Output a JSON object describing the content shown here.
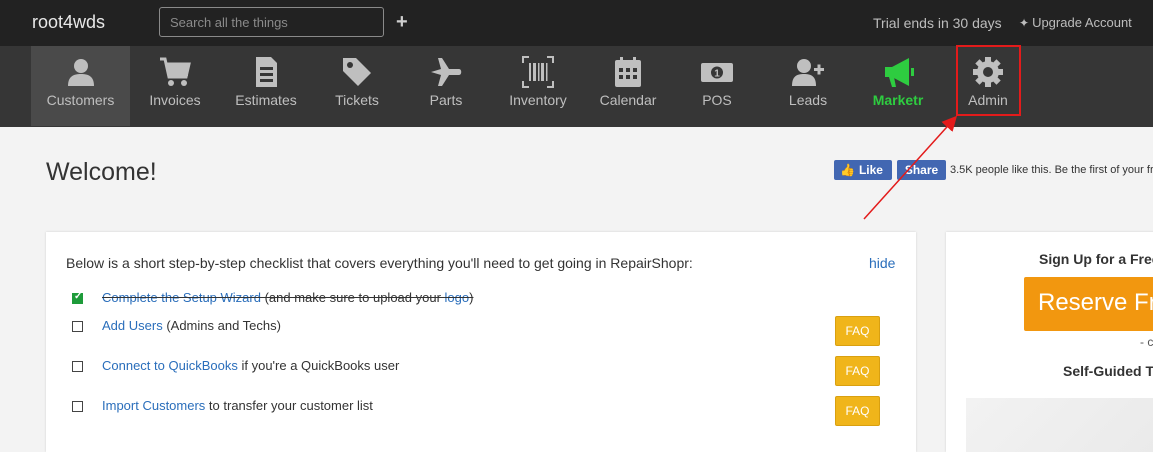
{
  "topbar": {
    "brand": "root4wds",
    "search_placeholder": "Search all the things",
    "add_symbol": "+",
    "trial_text": "Trial ends in 30 days",
    "upgrade_label": "Upgrade Account"
  },
  "nav": {
    "items": [
      {
        "label": "Customers",
        "icon": "user-icon"
      },
      {
        "label": "Invoices",
        "icon": "cart-icon"
      },
      {
        "label": "Estimates",
        "icon": "document-icon"
      },
      {
        "label": "Tickets",
        "icon": "tag-icon"
      },
      {
        "label": "Parts",
        "icon": "plane-icon"
      },
      {
        "label": "Inventory",
        "icon": "barcode-icon"
      },
      {
        "label": "Calendar",
        "icon": "calendar-icon"
      },
      {
        "label": "POS",
        "icon": "money-icon"
      },
      {
        "label": "Leads",
        "icon": "user-plus-icon"
      },
      {
        "label": "Marketr",
        "icon": "megaphone-icon"
      },
      {
        "label": "Admin",
        "icon": "gear-icon"
      }
    ]
  },
  "main": {
    "title": "Welcome!",
    "facebook": {
      "like_label": "Like",
      "share_label": "Share",
      "text": "3.5K people like this. Be the first of your fr"
    }
  },
  "checklist": {
    "intro": "Below is a short step-by-step checklist that covers everything you'll need to get going in RepairShopr:",
    "hide_label": "hide",
    "items": [
      {
        "link": "Complete the Setup Wizard",
        "pre": " (and make sure to upload your ",
        "link2": "logo",
        "post": ")",
        "done": true
      },
      {
        "link": "Add Users",
        "post": " (Admins and Techs)",
        "faq": "FAQ",
        "done": false
      },
      {
        "link": "Connect to QuickBooks",
        "post": " if you're a QuickBooks user",
        "faq": "FAQ",
        "done": false
      },
      {
        "link": "Import Customers",
        "post": " to transfer your customer list",
        "faq": "FAQ",
        "done": false
      }
    ]
  },
  "sidebar": {
    "title": "Sign Up for a Free",
    "reserve_label": "Reserve Fr",
    "or_text": "- c",
    "self_guided": "Self-Guided T"
  },
  "colors": {
    "topbar_bg": "#222222",
    "navbar_bg": "#363636",
    "marketr_green": "#2ecc40",
    "annotation_red": "#e31b1b",
    "faq_orange": "#f0b51a",
    "reserve_orange": "#f2970f",
    "link_blue": "#2a6ebb"
  }
}
